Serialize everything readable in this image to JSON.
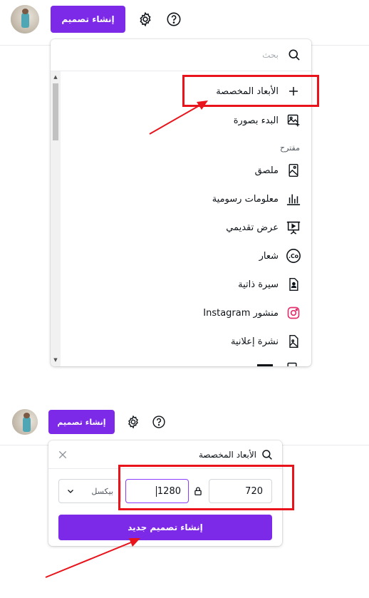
{
  "top1": {
    "create_label": "إنشاء تصميم",
    "search_placeholder": "بحث",
    "menu": {
      "custom_size": "الأبعاد المخصصة",
      "start_image": "البدء بصورة",
      "suggested_label": "مقترح",
      "items": [
        {
          "label": "ملصق",
          "icon": "poster-icon"
        },
        {
          "label": "معلومات رسومية",
          "icon": "infographic-icon"
        },
        {
          "label": "عرض تقديمي",
          "icon": "presentation-icon"
        },
        {
          "label": "شعار",
          "icon": "logo-icon"
        },
        {
          "label": "سيرة ذاتية",
          "icon": "resume-icon"
        },
        {
          "label": "منشور Instagram",
          "icon": "instagram-icon"
        },
        {
          "label": "نشرة إعلانية",
          "icon": "flyer-icon"
        }
      ]
    }
  },
  "top2": {
    "create_label": "إنشاء تصميم",
    "panel": {
      "title": "الأبعاد المخصصة",
      "width_value": "720",
      "height_value": "1280",
      "unit": "بيكسل",
      "submit_label": "إنشاء تصميم جديد"
    }
  },
  "colors": {
    "accent": "#7d2ae8",
    "annotation": "#e8131b",
    "instagram": "#e1306c"
  }
}
